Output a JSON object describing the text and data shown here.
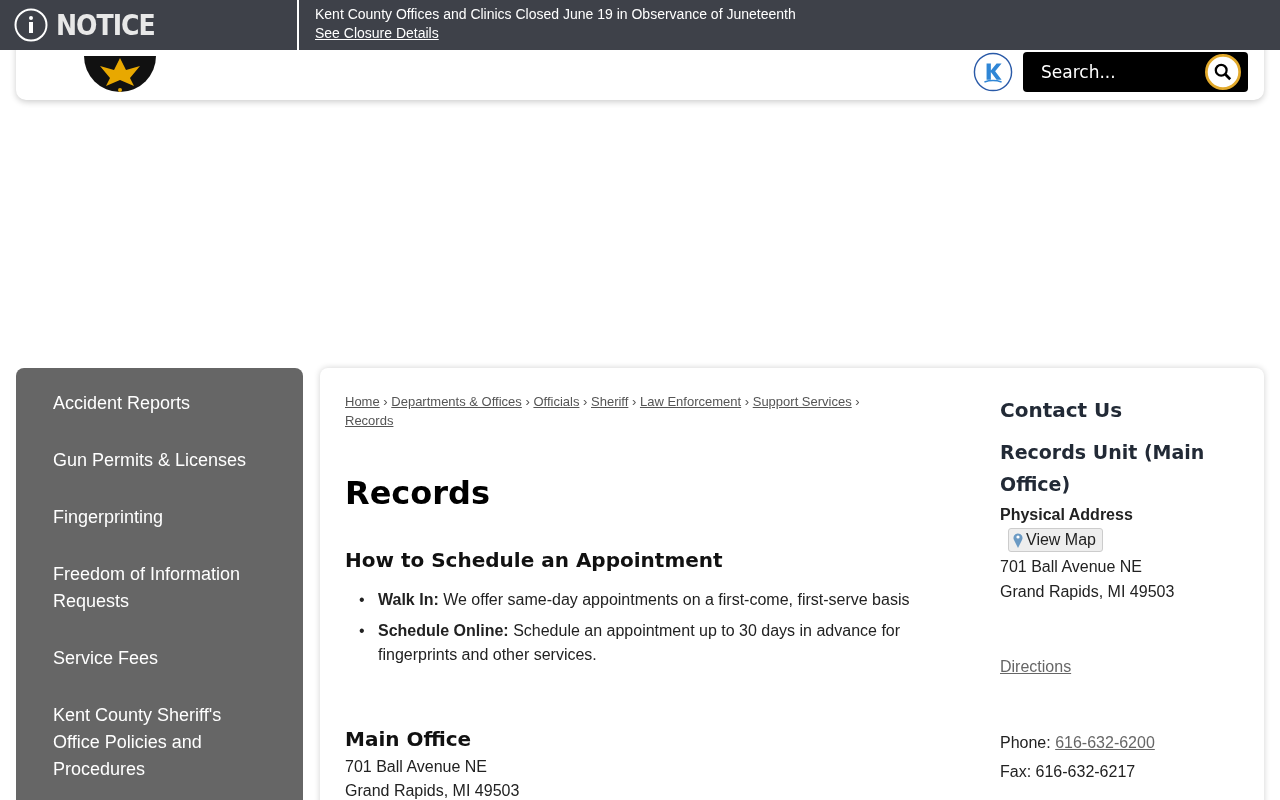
{
  "notice": {
    "label": "NOTICE",
    "message": "Kent County Offices and Clinics Closed June 19 in Observance of Juneteenth",
    "link": "See Closure Details"
  },
  "header": {
    "search": {
      "placeholder": "Search..."
    }
  },
  "sidebar": {
    "items": [
      {
        "label": "Accident Reports"
      },
      {
        "label": "Gun Permits & Licenses"
      },
      {
        "label": "Fingerprinting"
      },
      {
        "label": "Freedom of Information Requests"
      },
      {
        "label": "Service Fees"
      },
      {
        "label": "Kent County Sheriff's Office Policies and Procedures"
      }
    ]
  },
  "breadcrumb_separator": "›",
  "breadcrumbs": [
    "Home",
    "Departments & Offices",
    "Officials",
    "Sheriff",
    "Law Enforcement",
    "Support Services",
    "Records"
  ],
  "page_title": "Records",
  "appointment": {
    "heading": "How to Schedule an Appointment",
    "marker": "•",
    "items": [
      {
        "text": "**Walk In:** We offer same-day appointments on a first-come, first-serve basis"
      },
      {
        "text": "**Schedule Online:** Schedule an appointment up to 30 days in advance for fingerprints and other services."
      }
    ]
  },
  "main_office": {
    "heading": "Main Office",
    "lines": [
      "701 Ball Avenue NE",
      "Grand Rapids, MI 49503"
    ]
  },
  "contact": {
    "heading": "Contact Us",
    "unit": "Records Unit (Main Office)",
    "address_label": "Physical Address",
    "map_button": "View Map",
    "address_lines": [
      "701 Ball Avenue NE",
      "Grand Rapids, MI 49503"
    ],
    "directions": "Directions",
    "phone_label": "Phone:",
    "phone": "616-632-6200",
    "fax": "Fax: 616-632-6217"
  }
}
